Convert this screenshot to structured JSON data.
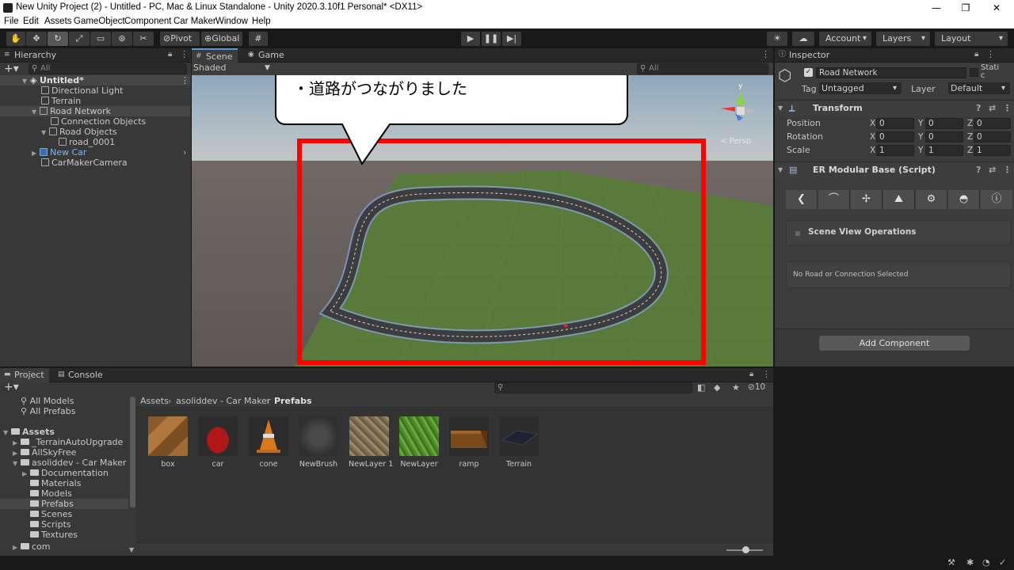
{
  "window": {
    "title": "New Unity Project (2) - Untitled - PC, Mac & Linux Standalone - Unity 2020.3.10f1 Personal* <DX11>",
    "minimize": "—",
    "maximize": "❐",
    "close": "✕"
  },
  "menu": [
    "File",
    "Edit",
    "Assets",
    "GameObject",
    "Component",
    "Car Maker",
    "Window",
    "Help"
  ],
  "toolbar": {
    "pivot": "Pivot",
    "global": "Global",
    "account": "Account",
    "layers": "Layers",
    "layout": "Layout"
  },
  "hierarchy": {
    "tab": "Hierarchy",
    "search_placeholder": "All",
    "scene_name": "Untitled*",
    "items": [
      {
        "label": "Directional Light"
      },
      {
        "label": "Terrain"
      },
      {
        "label": "Road Network"
      },
      {
        "label": "Connection Objects"
      },
      {
        "label": "Road Objects"
      },
      {
        "label": "road_0001"
      },
      {
        "label": "New Car"
      },
      {
        "label": "CarMakerCamera"
      }
    ]
  },
  "scene": {
    "tab_scene": "Scene",
    "tab_game": "Game",
    "shading": "Shaded",
    "search_placeholder": "All",
    "callout": "・道路がつながりました",
    "gizmo_label": "< Persp",
    "gizmo_axis": "y"
  },
  "inspector": {
    "tab": "Inspector",
    "object_name": "Road Network",
    "static_label": "Stati c",
    "tag_label": "Tag",
    "tag_value": "Untagged",
    "layer_label": "Layer",
    "layer_value": "Default",
    "transform": {
      "title": "Transform",
      "rows": [
        {
          "label": "Position",
          "x": "0",
          "y": "0",
          "z": "0"
        },
        {
          "label": "Rotation",
          "x": "0",
          "y": "0",
          "z": "0"
        },
        {
          "label": "Scale",
          "x": "1",
          "y": "1",
          "z": "1"
        }
      ]
    },
    "script": {
      "title": "ER Modular Base (Script)",
      "section": "Scene View Operations",
      "status": "No Road or Connection Selected"
    },
    "add_component": "Add Component",
    "xyz": [
      "X",
      "Y",
      "Z"
    ]
  },
  "project": {
    "tab_project": "Project",
    "tab_console": "Console",
    "favorites": [
      "All Models",
      "All Prefabs"
    ],
    "assets_root": "Assets",
    "tree": [
      {
        "label": "_TerrainAutoUpgrade",
        "level": 1
      },
      {
        "label": "AllSkyFree",
        "level": 1
      },
      {
        "label": "asoliddev - Car Maker",
        "level": 1
      },
      {
        "label": "Documentation",
        "level": 2
      },
      {
        "label": "Materials",
        "level": 2
      },
      {
        "label": "Models",
        "level": 2
      },
      {
        "label": "Prefabs",
        "level": 2
      },
      {
        "label": "Scenes",
        "level": 2
      },
      {
        "label": "Scripts",
        "level": 2
      },
      {
        "label": "Textures",
        "level": 2
      },
      {
        "label": "com",
        "level": 1
      }
    ],
    "breadcrumb": [
      "Assets",
      "asoliddev - Car Maker",
      "Prefabs"
    ],
    "hidden_count": "10",
    "assets": [
      {
        "label": "box"
      },
      {
        "label": "car"
      },
      {
        "label": "cone"
      },
      {
        "label": "NewBrush"
      },
      {
        "label": "NewLayer 1"
      },
      {
        "label": "NewLayer"
      },
      {
        "label": "ramp"
      },
      {
        "label": "Terrain"
      }
    ]
  }
}
